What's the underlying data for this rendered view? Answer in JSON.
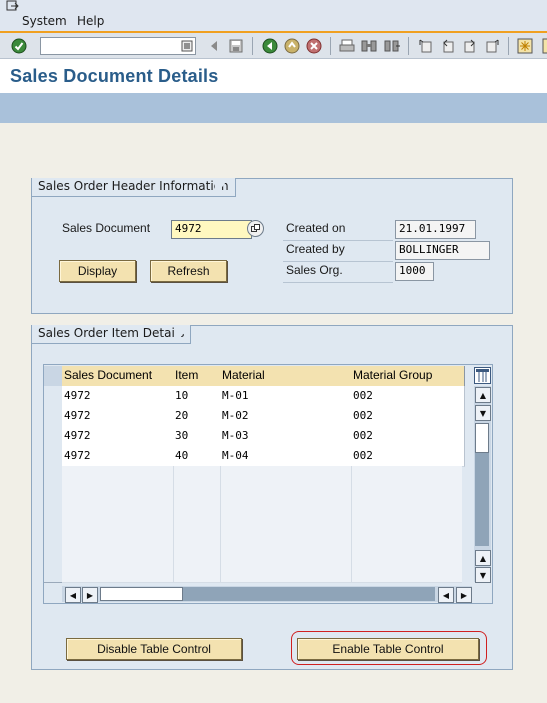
{
  "menu": {
    "items": [
      {
        "label": "System",
        "underline": "S"
      },
      {
        "label": "Help",
        "underline": "H"
      }
    ]
  },
  "toolbar": {
    "command_value": "",
    "icons": [
      "enter-icon",
      "dropdown-icon",
      "back-icon",
      "save-icon",
      "back-arrow-icon",
      "exit-icon",
      "cancel-icon",
      "print-icon",
      "find-icon",
      "find-next-icon",
      "first-page-icon",
      "prev-page-icon",
      "next-page-icon",
      "last-page-icon",
      "new-session-icon",
      "shortcut-icon"
    ]
  },
  "page": {
    "title": "Sales Document Details"
  },
  "header_group": {
    "title": "Sales Order Header Information",
    "sales_document_label": "Sales Document",
    "sales_document_value": "4972",
    "created_on_label": "Created on",
    "created_on_value": "21.01.1997",
    "created_by_label": "Created by",
    "created_by_value": "BOLLINGER",
    "sales_org_label": "Sales Org.",
    "sales_org_value": "1000",
    "display_button": "Display",
    "refresh_button": "Refresh"
  },
  "items_group": {
    "title": "Sales Order Item Details",
    "columns": [
      "Sales Document",
      "Item",
      "Material",
      "Material Group"
    ],
    "rows": [
      [
        "4972",
        "10",
        "M-01",
        "002"
      ],
      [
        "4972",
        "20",
        "M-02",
        "002"
      ],
      [
        "4972",
        "30",
        "M-03",
        "002"
      ],
      [
        "4972",
        "40",
        "M-04",
        "002"
      ]
    ],
    "empty_rows": 6,
    "disable_button": "Disable Table Control",
    "enable_button": "Enable Table Control"
  },
  "colors": {
    "title": "#2a5d8a",
    "group_bg": "#dfe8f1",
    "button_bg": "#f3e2b0",
    "input_bg": "#fff8c0",
    "highlight": "#d02020"
  }
}
